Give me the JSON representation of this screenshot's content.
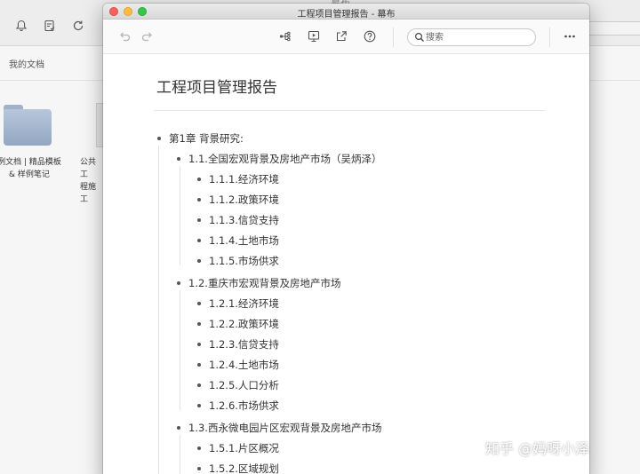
{
  "background_app": {
    "title_text": "幕布",
    "tab_label": "我的文档",
    "items": [
      {
        "label_line1": "例文档 | 精品模板",
        "label_line2": "& 样例笔记"
      },
      {
        "label_line1": "公共工",
        "label_line2": "程施工"
      }
    ]
  },
  "window": {
    "title": "工程项目管理报告 - 幕布",
    "search": {
      "placeholder": "搜索",
      "value": ""
    }
  },
  "icons": {
    "bell": "bell-icon",
    "tasks": "checklist-icon",
    "refresh": "refresh-icon",
    "undo": "undo-icon",
    "redo": "redo-icon",
    "mindmap": "mindmap-icon",
    "present": "presentation-icon",
    "share": "share-icon",
    "help": "help-icon",
    "more": "more-icon"
  },
  "document": {
    "title": "工程项目管理报告",
    "outline": [
      {
        "level": 0,
        "text": "第1章 背景研究:"
      },
      {
        "level": 1,
        "text": "1.1.全国宏观背景及房地产市场（吴炳泽）"
      },
      {
        "level": 2,
        "text": "1.1.1.经济环境"
      },
      {
        "level": 2,
        "text": "1.1.2.政策环境"
      },
      {
        "level": 2,
        "text": "1.1.3.信贷支持"
      },
      {
        "level": 2,
        "text": "1.1.4.土地市场"
      },
      {
        "level": 2,
        "text": "1.1.5.市场供求"
      },
      {
        "level": 1,
        "text": "1.2.重庆市宏观背景及房地产市场"
      },
      {
        "level": 2,
        "text": "1.2.1.经济环境"
      },
      {
        "level": 2,
        "text": "1.2.2.政策环境"
      },
      {
        "level": 2,
        "text": "1.2.3.信贷支持"
      },
      {
        "level": 2,
        "text": "1.2.4.土地市场"
      },
      {
        "level": 2,
        "text": "1.2.5.人口分析"
      },
      {
        "level": 2,
        "text": "1.2.6.市场供求"
      },
      {
        "level": 1,
        "text": "1.3.西永微电园片区宏观背景及房地产市场"
      },
      {
        "level": 2,
        "text": "1.5.1.片区概况"
      },
      {
        "level": 2,
        "text": "1.5.2.区域规划"
      }
    ]
  },
  "watermark": "知乎 @妈呀小泽"
}
